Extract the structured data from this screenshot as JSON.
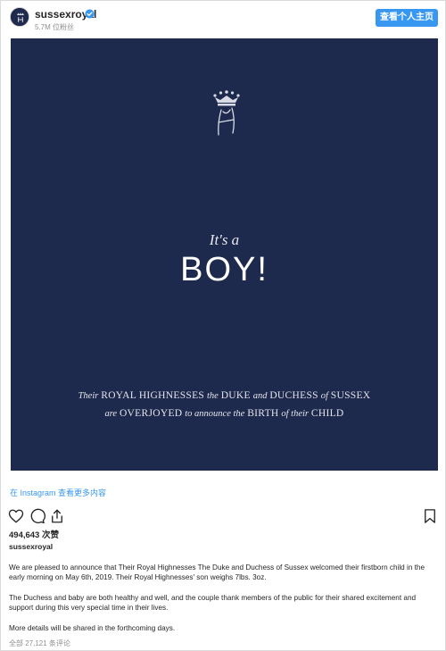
{
  "header": {
    "username": "sussexroyal",
    "followers": "5.7M 位粉丝",
    "profile_button": "查看个人主页"
  },
  "post": {
    "its_a": "It's a",
    "boy": "BOY!",
    "announce_line1": {
      "w1": "Their",
      "w2": "ROYAL HIGHNESSES",
      "w3": "the",
      "w4": "DUKE",
      "w5": "and",
      "w6": "DUCHESS",
      "w7": "of",
      "w8": "SUSSEX"
    },
    "announce_line2": {
      "w1": "are",
      "w2": "OVERJOYED",
      "w3": "to announce the",
      "w4": "BIRTH",
      "w5": "of their",
      "w6": "CHILD"
    },
    "background_color": "#1e2a4d"
  },
  "view_more": "在 Instagram 查看更多内容",
  "likes": "494,643 次赞",
  "caption": {
    "username": "sussexroyal",
    "p1": "We are pleased to announce that Their Royal Highnesses The Duke and Duchess of Sussex welcomed their firstborn child in the early morning on May 6th, 2019. Their Royal Highnesses' son weighs 7lbs. 3oz.",
    "p2": "The Duchess and baby are both healthy and well, and the couple thank members of the public for their shared excitement and support during this very special time in their lives.",
    "p3": "More details will be shared in the forthcoming days."
  },
  "comments_link": "全部 27,121 条评论",
  "colors": {
    "accent": "#3897f0",
    "navy": "#1e2a4d"
  }
}
